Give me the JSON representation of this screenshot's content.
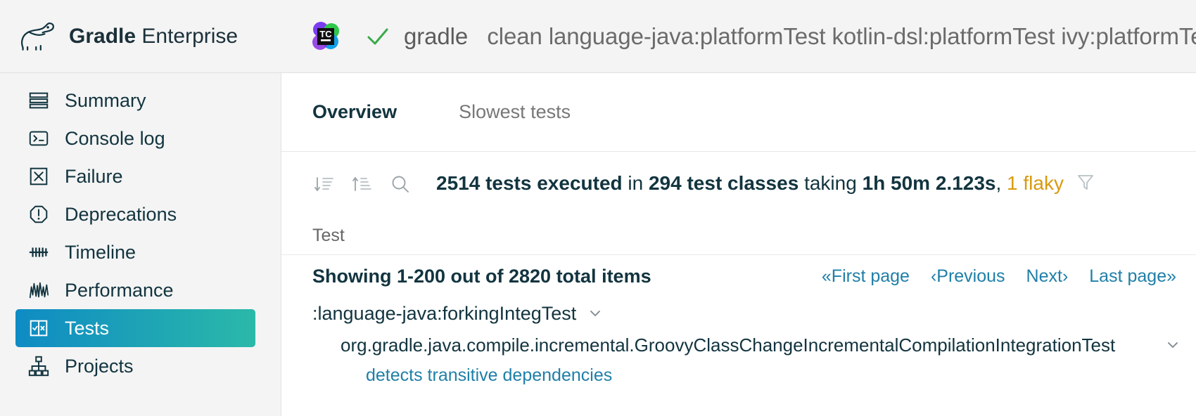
{
  "header": {
    "brand_bold": "Gradle",
    "brand_light": "Enterprise",
    "brand_logo_icon": "gradle-elephant-logo",
    "ci_icon": "teamcity-icon",
    "status_icon": "check-success-icon",
    "build_command": "gradle",
    "build_args": "clean language-java:platformTest kotlin-dsl:platformTest ivy:platformTe",
    "accent_success": "#3aaa4a"
  },
  "sidebar": {
    "items": [
      {
        "label": "Summary",
        "icon": "lines-summary-icon",
        "active": false
      },
      {
        "label": "Console log",
        "icon": "terminal-icon",
        "active": false
      },
      {
        "label": "Failure",
        "icon": "x-square-icon",
        "active": false
      },
      {
        "label": "Deprecations",
        "icon": "warning-octagon-icon",
        "active": false
      },
      {
        "label": "Timeline",
        "icon": "timeline-icon",
        "active": false
      },
      {
        "label": "Performance",
        "icon": "waveform-icon",
        "active": false
      },
      {
        "label": "Tests",
        "icon": "tests-check-x-icon",
        "active": true
      },
      {
        "label": "Projects",
        "icon": "hierarchy-icon",
        "active": false
      }
    ],
    "active_gradient_from": "#0e8bc4",
    "active_gradient_to": "#2bb9a9"
  },
  "main": {
    "tabs": [
      {
        "label": "Overview",
        "active": true
      },
      {
        "label": "Slowest tests",
        "active": false
      }
    ],
    "toolbar": {
      "sort_desc_icon": "sort-descending-icon",
      "sort_asc_icon": "sort-ascending-icon",
      "search_icon": "search-icon",
      "filter_icon": "filter-funnel-icon"
    },
    "stats": {
      "test_count": "2514",
      "tests_word": "tests executed",
      "in_word": "in",
      "class_count": "294",
      "classes_word": "test classes",
      "taking_word": "taking",
      "duration": "1h 50m 2.123s",
      "separator": ", ",
      "flaky": "1 flaky",
      "flaky_color": "#d99a10"
    },
    "annotation": {
      "name": "flaky-highlight-box",
      "color": "#e01b1b"
    },
    "column_header": "Test",
    "paging": {
      "showing": "Showing 1-200 out of 2820 total items",
      "first": "«First page",
      "previous": "‹Previous",
      "next": "Next›",
      "last": "Last page»",
      "link_color": "#1f7fa8"
    },
    "rows": [
      {
        "type": "task",
        "text": ":language-java:forkingIntegTest",
        "chevron": "chevron-down-icon"
      },
      {
        "type": "class",
        "text": "org.gradle.java.compile.incremental.GroovyClassChangeIncrementalCompilationIntegrationTest",
        "chevron": "chevron-down-icon"
      },
      {
        "type": "test",
        "text": "detects transitive dependencies"
      }
    ]
  }
}
